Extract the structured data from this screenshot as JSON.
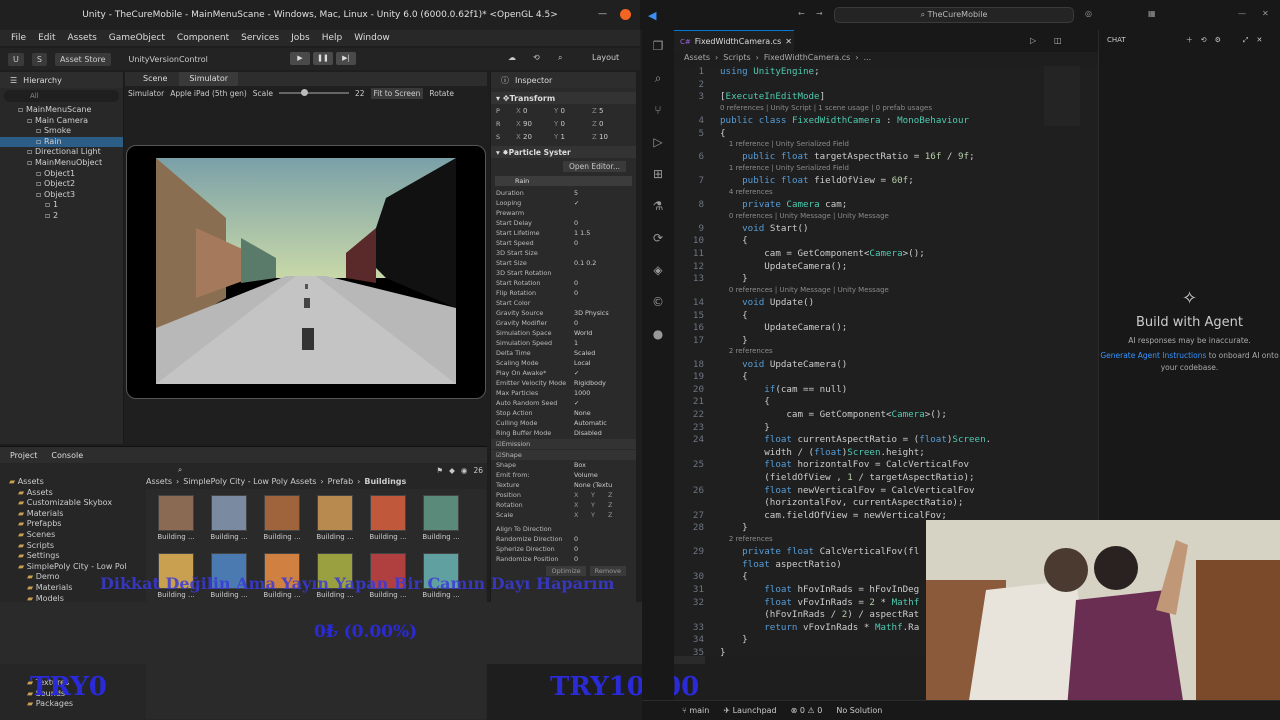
{
  "unity": {
    "window_title": "Unity - TheCureMobile - MainMenuScane - Windows, Mac, Linux - Unity 6.0 (6000.0.62f1)* <OpenGL 4.5>",
    "menu": [
      "File",
      "Edit",
      "Assets",
      "GameObject",
      "Component",
      "Services",
      "Jobs",
      "Help",
      "Window"
    ],
    "toolbar": {
      "account": "S",
      "asset_store": "Asset Store",
      "version_control": "UnityVersionControl",
      "layout": "Layout"
    },
    "hierarchy": {
      "tab": "Hierarchy",
      "search_placeholder": "All",
      "rows": [
        {
          "label": "MainMenuScane",
          "indent": 2,
          "selected": false
        },
        {
          "label": "Main Camera",
          "indent": 3,
          "selected": false
        },
        {
          "label": "Smoke",
          "indent": 4,
          "selected": false
        },
        {
          "label": "Rain",
          "indent": 4,
          "selected": true
        },
        {
          "label": "Directional Light",
          "indent": 3,
          "selected": false
        },
        {
          "label": "MainMenuObject",
          "indent": 3,
          "selected": false
        },
        {
          "label": "Object1",
          "indent": 4,
          "selected": false
        },
        {
          "label": "Object2",
          "indent": 4,
          "selected": false
        },
        {
          "label": "Object3",
          "indent": 4,
          "selected": false
        },
        {
          "label": "1",
          "indent": 5,
          "selected": false
        },
        {
          "label": "2",
          "indent": 5,
          "selected": false
        }
      ]
    },
    "simulator": {
      "tabs": [
        "Scene",
        "Simulator"
      ],
      "mode": "Simulator",
      "device": "Apple iPad (5th gen)",
      "scale_label": "Scale",
      "scale_value": "22",
      "fit_label": "Fit to Screen",
      "rotate_label": "Rotate"
    },
    "inspector": {
      "tab": "Inspector",
      "transform_title": "Transform",
      "transform_rows": [
        {
          "label": "P",
          "x": "0",
          "y": "0",
          "z": "5"
        },
        {
          "label": "R",
          "x": "90",
          "y": "0",
          "z": "0"
        },
        {
          "label": "S",
          "x": "20",
          "y": "1",
          "z": "10"
        }
      ],
      "ps_title": "Particle Syster",
      "open_editor": "Open Editor...",
      "ps_name": "Rain",
      "props": [
        {
          "label": "Duration",
          "value": "5"
        },
        {
          "label": "Looping",
          "value": "✓"
        },
        {
          "label": "Prewarm",
          "value": ""
        },
        {
          "label": "Start Delay",
          "value": "0"
        },
        {
          "label": "Start Lifetime",
          "value": "1     1.5"
        },
        {
          "label": "Start Speed",
          "value": "0"
        },
        {
          "label": "3D Start Size",
          "value": ""
        },
        {
          "label": "Start Size",
          "value": "0.1   0.2"
        },
        {
          "label": "3D Start Rotation",
          "value": ""
        },
        {
          "label": "Start Rotation",
          "value": "0"
        },
        {
          "label": "Flip Rotation",
          "value": "0"
        },
        {
          "label": "Start Color",
          "value": ""
        },
        {
          "label": "Gravity Source",
          "value": "3D Physics"
        },
        {
          "label": "Gravity Modifier",
          "value": "0"
        },
        {
          "label": "Simulation Space",
          "value": "World"
        },
        {
          "label": "Simulation Speed",
          "value": "1"
        },
        {
          "label": "Delta Time",
          "value": "Scaled"
        },
        {
          "label": "Scaling Mode",
          "value": "Local"
        },
        {
          "label": "Play On Awake*",
          "value": "✓"
        },
        {
          "label": "Emitter Velocity Mode",
          "value": "Rigidbody"
        },
        {
          "label": "Max Particles",
          "value": "1000"
        },
        {
          "label": "Auto Random Seed",
          "value": "✓"
        },
        {
          "label": "Stop Action",
          "value": "None"
        },
        {
          "label": "Culling Mode",
          "value": "Automatic"
        },
        {
          "label": "Ring Buffer Mode",
          "value": "Disabled"
        }
      ],
      "modules": [
        "Emission",
        "Shape"
      ],
      "shape_rows": [
        {
          "label": "Shape",
          "value": "Box"
        },
        {
          "label": "Emit from:",
          "value": "Volume"
        },
        {
          "label": "Texture",
          "value": "None (Textu"
        }
      ],
      "xyz_rows": [
        "Position",
        "Rotation",
        "Scale"
      ],
      "extra_rows": [
        {
          "label": "Align To Direction",
          "value": ""
        },
        {
          "label": "Randomize Direction",
          "value": "0"
        },
        {
          "label": "Spherize Direction",
          "value": "0"
        },
        {
          "label": "Randomize Position",
          "value": "0"
        }
      ],
      "buttons": [
        "Optimize",
        "Remove"
      ]
    },
    "project": {
      "tabs": [
        "Project",
        "Console"
      ],
      "count": "26",
      "tree": [
        {
          "label": "Assets",
          "indent": 1
        },
        {
          "label": "Assets",
          "indent": 2
        },
        {
          "label": "Customizable Skybox",
          "indent": 2
        },
        {
          "label": "Materials",
          "indent": 2
        },
        {
          "label": "Prefapbs",
          "indent": 2
        },
        {
          "label": "Scenes",
          "indent": 2
        },
        {
          "label": "Scripts",
          "indent": 2
        },
        {
          "label": "Settings",
          "indent": 2
        },
        {
          "label": "SimplePoly City - Low Pol",
          "indent": 2
        },
        {
          "label": "Demo",
          "indent": 3
        },
        {
          "label": "Materials",
          "indent": 3
        },
        {
          "label": "Models",
          "indent": 3
        }
      ],
      "tree_bottom": [
        "Textures",
        "Sounds",
        "Packages"
      ],
      "breadcrumb": [
        "Assets",
        "SimplePoly City - Low Poly Assets",
        "Prefab",
        "Buildings"
      ],
      "assets": [
        "Building ...",
        "Building ...",
        "Building ...",
        "Building ...",
        "Building ...",
        "Building ...",
        "Building ...",
        "Building ...",
        "Building ...",
        "Building ...",
        "Building ...",
        "Building ..."
      ],
      "asset_colors": [
        "#8a6a52",
        "#7a8aa0",
        "#a0643c",
        "#b88a50",
        "#c0583c",
        "#5a8a7a",
        "#c8a050",
        "#4a7ab0",
        "#d08040",
        "#9aa040",
        "#b04040",
        "#60a0a0"
      ]
    }
  },
  "overlay": {
    "banner": "Dikkat Değilin Ama Yayın Yapan Bir Camın Dayı Haparım",
    "progress_text": "0₺ (0.00%)",
    "progress_fraction": 0.0,
    "left_amount": "TRY0",
    "right_amount": "TRY10000"
  },
  "vscode": {
    "search": "TheCureMobile",
    "tab": "FixedWidthCamera.cs",
    "breadcrumb": [
      "Assets",
      "Scripts",
      "FixedWidthCamera.cs",
      "..."
    ],
    "chat": {
      "header": "CHAT",
      "title": "Build with Agent",
      "line1": "AI responses may be inaccurate.",
      "link": "Generate Agent Instructions",
      "line2": "to onboard AI onto your codebase."
    },
    "status": {
      "branch": "main",
      "launchpad": "Launchpad",
      "errors": "0",
      "warnings": "0",
      "solution": "No Solution"
    },
    "code": [
      {
        "n": "1",
        "t": "using UnityEngine;"
      },
      {
        "n": "2",
        "t": ""
      },
      {
        "n": "3",
        "t": "[ExecuteInEditMode]"
      },
      {
        "lens": "0 references | Unity Script | 1 scene usage | 0 prefab usages"
      },
      {
        "n": "4",
        "t": "public class FixedWidthCamera : MonoBehaviour"
      },
      {
        "n": "5",
        "t": "{"
      },
      {
        "lens": "    1 reference | Unity Serialized Field"
      },
      {
        "n": "6",
        "t": "    public float targetAspectRatio = 16f / 9f;"
      },
      {
        "lens": "    1 reference | Unity Serialized Field"
      },
      {
        "n": "7",
        "t": "    public float fieldOfView = 60f;"
      },
      {
        "lens": "    4 references"
      },
      {
        "n": "8",
        "t": "    private Camera cam;"
      },
      {
        "lens": "    0 references | Unity Message | Unity Message"
      },
      {
        "n": "9",
        "t": "    void Start()"
      },
      {
        "n": "10",
        "t": "    {"
      },
      {
        "n": "11",
        "t": "        cam = GetComponent<Camera>();"
      },
      {
        "n": "12",
        "t": "        UpdateCamera();"
      },
      {
        "n": "13",
        "t": "    }"
      },
      {
        "lens": "    0 references | Unity Message | Unity Message"
      },
      {
        "n": "14",
        "t": "    void Update()"
      },
      {
        "n": "15",
        "t": "    {"
      },
      {
        "n": "16",
        "t": "        UpdateCamera();"
      },
      {
        "n": "17",
        "t": "    }"
      },
      {
        "lens": "    2 references"
      },
      {
        "n": "18",
        "t": "    void UpdateCamera()"
      },
      {
        "n": "19",
        "t": "    {"
      },
      {
        "n": "20",
        "t": "        if(cam == null)"
      },
      {
        "n": "21",
        "t": "        {"
      },
      {
        "n": "22",
        "t": "            cam = GetComponent<Camera>();"
      },
      {
        "n": "23",
        "t": "        }"
      },
      {
        "n": "24",
        "t": "        float currentAspectRatio = (float)Screen."
      },
      {
        "n": "",
        "t": "        width / (float)Screen.height;"
      },
      {
        "n": "25",
        "t": "        float horizontalFov = CalcVerticalFov"
      },
      {
        "n": "",
        "t": "        (fieldOfView , 1 / targetAspectRatio);"
      },
      {
        "n": "26",
        "t": "        float newVerticalFov = CalcVerticalFov"
      },
      {
        "n": "",
        "t": "        (horizontalFov, currentAspectRatio);"
      },
      {
        "n": "27",
        "t": "        cam.fieldOfView = newVerticalFov;"
      },
      {
        "n": "28",
        "t": "    }"
      },
      {
        "lens": "    2 references"
      },
      {
        "n": "29",
        "t": "    private float CalcVerticalFov(fl"
      },
      {
        "n": "",
        "t": "    float aspectRatio)"
      },
      {
        "n": "30",
        "t": "    {"
      },
      {
        "n": "31",
        "t": "        float hFovInRads = hFovInDeg"
      },
      {
        "n": "32",
        "t": "        float vFovInRads = 2 * Mathf"
      },
      {
        "n": "",
        "t": "        (hFovInRads / 2) / aspectRat"
      },
      {
        "n": "33",
        "t": "        return vFovInRads * Mathf.Ra"
      },
      {
        "n": "34",
        "t": "    }"
      },
      {
        "n": "35",
        "t": "}"
      }
    ]
  }
}
